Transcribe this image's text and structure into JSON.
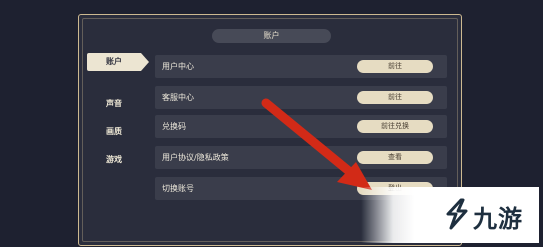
{
  "title": "账户",
  "tabs": [
    {
      "label": "账户",
      "active": true
    },
    {
      "label": "声音",
      "active": false
    },
    {
      "label": "画质",
      "active": false
    },
    {
      "label": "游戏",
      "active": false
    }
  ],
  "rows": [
    {
      "label": "用户中心",
      "button": "前往"
    },
    {
      "label": "客服中心",
      "button": "前往"
    },
    {
      "label": "兑换码",
      "button": "前往兑换"
    },
    {
      "label": "用户协议/隐私政策",
      "button": "查看"
    },
    {
      "label": "切换账号",
      "button": "登出"
    }
  ],
  "watermark": {
    "text": "九游"
  },
  "colors": {
    "background": "#1e2130",
    "panel": "#2a2d3c",
    "gold_border": "#cdb991",
    "button_fill": "#e6dcc2",
    "arrow": "#d22a17"
  }
}
